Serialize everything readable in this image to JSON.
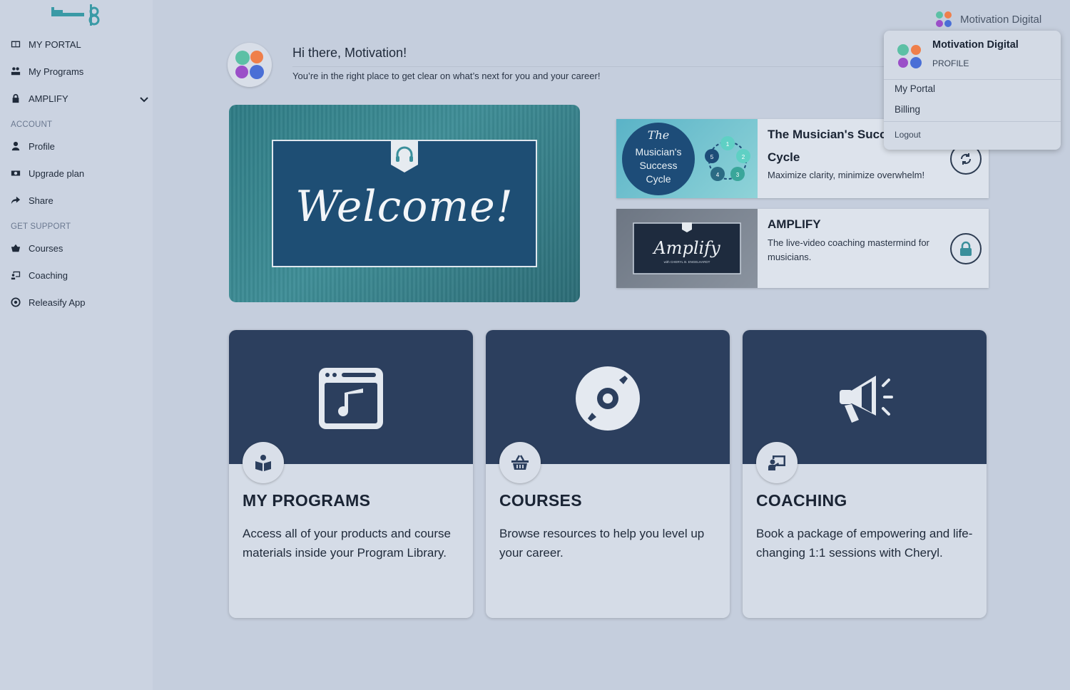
{
  "sidebar": {
    "items": [
      {
        "label": "MY PORTAL",
        "icon": "table-icon"
      },
      {
        "label": "My Programs",
        "icon": "programs-icon"
      },
      {
        "label": "AMPLIFY",
        "icon": "lock-icon"
      }
    ],
    "account_header": "ACCOUNT",
    "account_items": [
      {
        "label": "Profile",
        "icon": "user-icon"
      },
      {
        "label": "Upgrade plan",
        "icon": "money-icon"
      },
      {
        "label": "Share",
        "icon": "share-icon"
      }
    ],
    "support_header": "GET SUPPORT",
    "support_items": [
      {
        "label": "Courses",
        "icon": "basket-icon"
      },
      {
        "label": "Coaching",
        "icon": "chalkboard-icon"
      },
      {
        "label": "Releasify App",
        "icon": "target-icon"
      }
    ]
  },
  "header": {
    "user_name": "Motivation Digital"
  },
  "greeting": {
    "title": "Hi there, Motivation!",
    "subtitle": "You’re in the right place to get clear on what’s next for you and your career!"
  },
  "welcome_banner": {
    "text": "Welcome!"
  },
  "programs": [
    {
      "title_line1": "The Musician's Succe",
      "title_line2": "Cycle",
      "description": "Maximize clarity, minimize overwhelm!",
      "thumb_text": [
        "The",
        "Musician's",
        "Success",
        "Cycle"
      ],
      "cycle_numbers": [
        "1",
        "2",
        "3",
        "4",
        "5"
      ],
      "action_icon": "refresh-icon"
    },
    {
      "title_line1": "AMPLIFY",
      "description_line1": "The live-video coaching mastermind for",
      "description_line2": "musicians.",
      "thumb_text": "Amplify",
      "thumb_subtext": "with CHERYL B. ENGELHARDT",
      "action_icon": "lock-icon"
    }
  ],
  "cards": [
    {
      "title": "MY PROGRAMS",
      "description": "Access all of your products and course materials inside your Program Library.",
      "icon": "music-window-icon",
      "badge_icon": "book-reader-icon"
    },
    {
      "title": "COURSES",
      "description": "Browse resources to help you level up your career.",
      "icon": "disc-icon",
      "badge_icon": "basket-icon"
    },
    {
      "title": "COACHING",
      "description": "Book a package of empowering and life-changing 1:1 sessions with Cheryl.",
      "icon": "megaphone-icon",
      "badge_icon": "chalkboard-teacher-icon"
    }
  ],
  "dropdown": {
    "name": "Motivation Digital",
    "role": "PROFILE",
    "items": [
      "My Portal",
      "Billing"
    ],
    "logout": "Logout"
  },
  "colors": {
    "brand_dots": [
      "#5cc0a5",
      "#ef7f4a",
      "#9b4fc8",
      "#4a6fd6"
    ],
    "card_header": "#2c3f5e",
    "welcome_teal": "#3f8e97"
  }
}
